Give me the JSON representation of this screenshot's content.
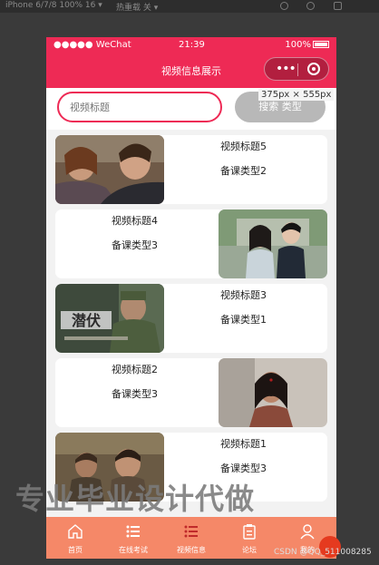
{
  "devtools": {
    "device": "iPhone 6/7/8 100% 16 ▾",
    "hotreload": "热重载 关 ▾"
  },
  "status_bar": {
    "signal": "●●●●● WeChat",
    "time": "21:39",
    "battery": "100%"
  },
  "navbar": {
    "title": "视频信息展示",
    "more_glyph": "•••"
  },
  "search": {
    "placeholder": "视频标题",
    "button_label": "搜索 类型"
  },
  "devtools_size_label": "375px × 555px",
  "videos": [
    {
      "title": "视频标题5",
      "type": "备课类型2"
    },
    {
      "title": "视频标题4",
      "type": "备课类型3"
    },
    {
      "title": "视频标题3",
      "type": "备课类型1"
    },
    {
      "title": "视频标题2",
      "type": "备课类型3"
    },
    {
      "title": "视频标题1",
      "type": "备课类型3"
    }
  ],
  "tabs": [
    {
      "label": "首页",
      "icon": "home-icon"
    },
    {
      "label": "在线考试",
      "icon": "list-icon"
    },
    {
      "label": "视频信息",
      "icon": "list-icon"
    },
    {
      "label": "论坛",
      "icon": "clipboard-icon"
    },
    {
      "label": "我的",
      "icon": "user-icon"
    }
  ],
  "watermark": "专业毕业设计代做",
  "csdn_credit": "CSDN @QQ_511008285",
  "colors": {
    "accent": "#ee2a55",
    "tabbar": "#f58868",
    "search_button": "#b8b8b8"
  }
}
